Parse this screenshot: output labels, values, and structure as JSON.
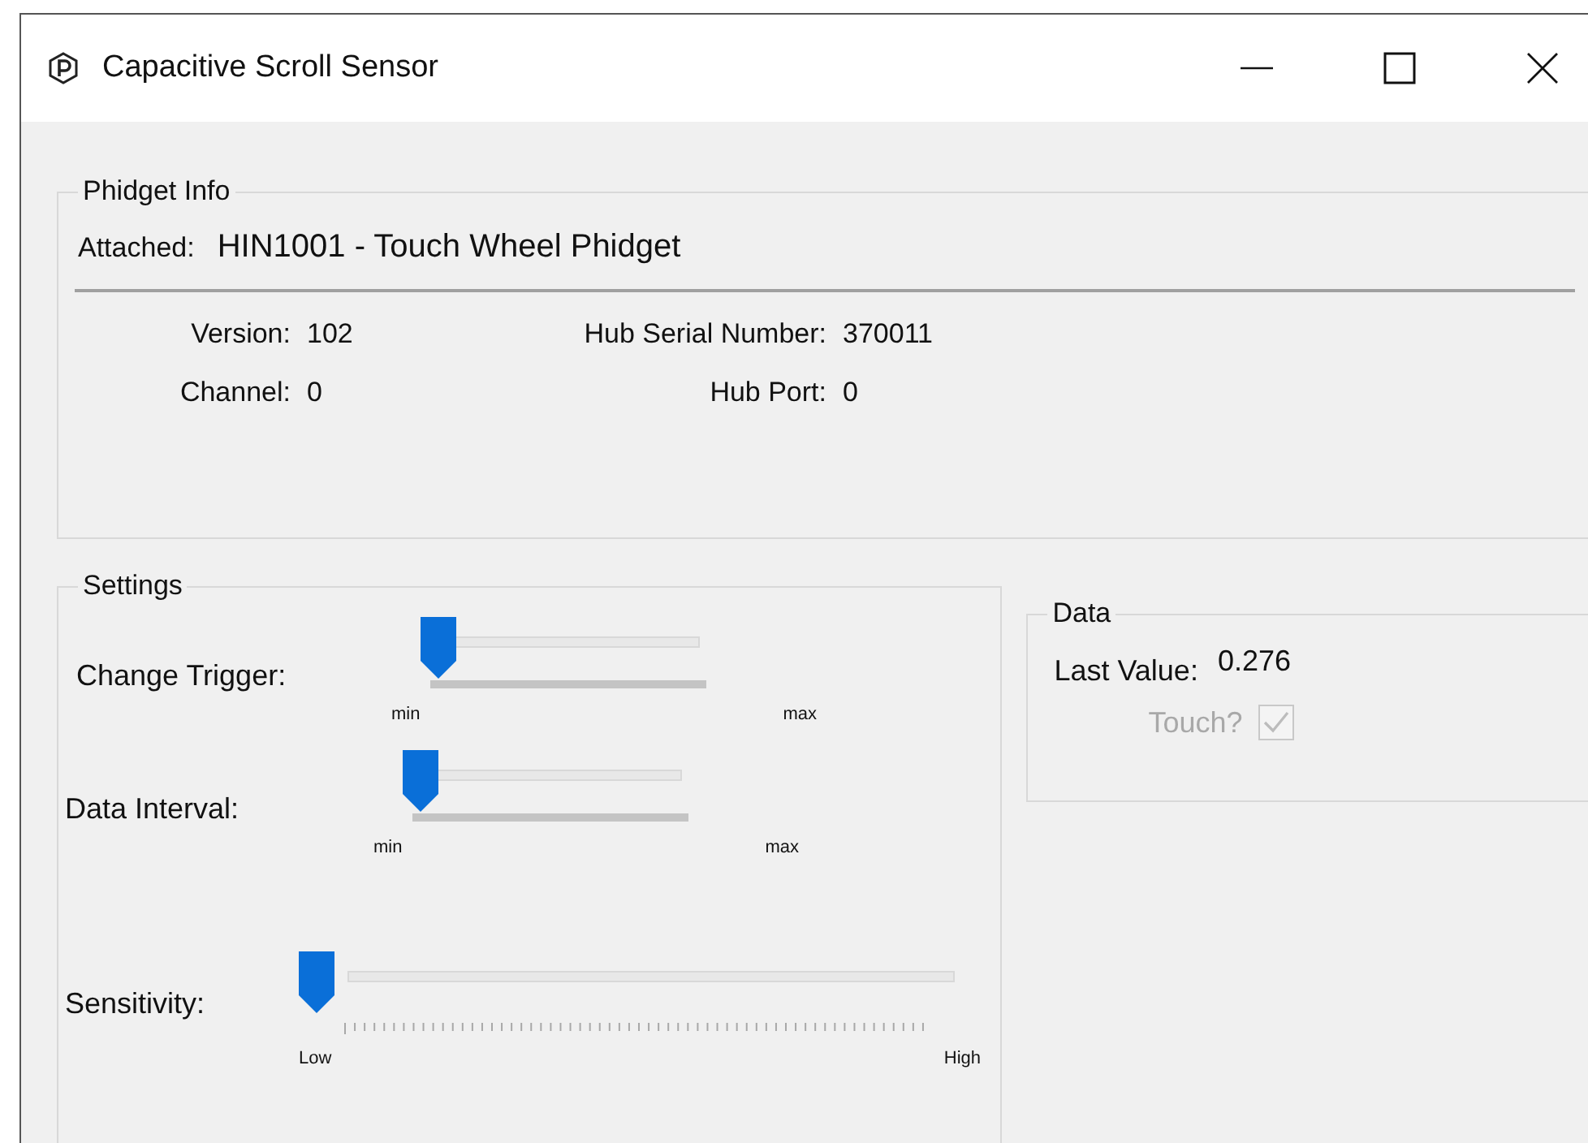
{
  "window": {
    "title": "Capacitive Scroll Sensor"
  },
  "phidget_info": {
    "title": "Phidget Info",
    "attached_label": "Attached:",
    "attached_value": "HIN1001 - Touch Wheel Phidget",
    "fields": [
      {
        "label": "Version:",
        "value": "102"
      },
      {
        "label": "Hub Serial Number:",
        "value": "370011"
      },
      {
        "label": "Channel:",
        "value": "0"
      },
      {
        "label": "Hub Port:",
        "value": "0"
      }
    ]
  },
  "settings": {
    "title": "Settings",
    "sliders": [
      {
        "kind": "range",
        "label": "Change Trigger:",
        "level": 0,
        "min_label": "min",
        "max_label": "max"
      },
      {
        "kind": "range",
        "label": "Data Interval:",
        "level": 0,
        "min_label": "min",
        "max_label": "max"
      },
      {
        "kind": "ticked",
        "label": "Sensitivity:",
        "level": 0,
        "min_label": "Low",
        "max_label": "High"
      }
    ]
  },
  "data": {
    "title": "Data",
    "last_value_label": "Last Value:",
    "last_value": "0.276",
    "touch_label": "Touch?",
    "touch_checked": true,
    "touch_disabled": true
  }
}
